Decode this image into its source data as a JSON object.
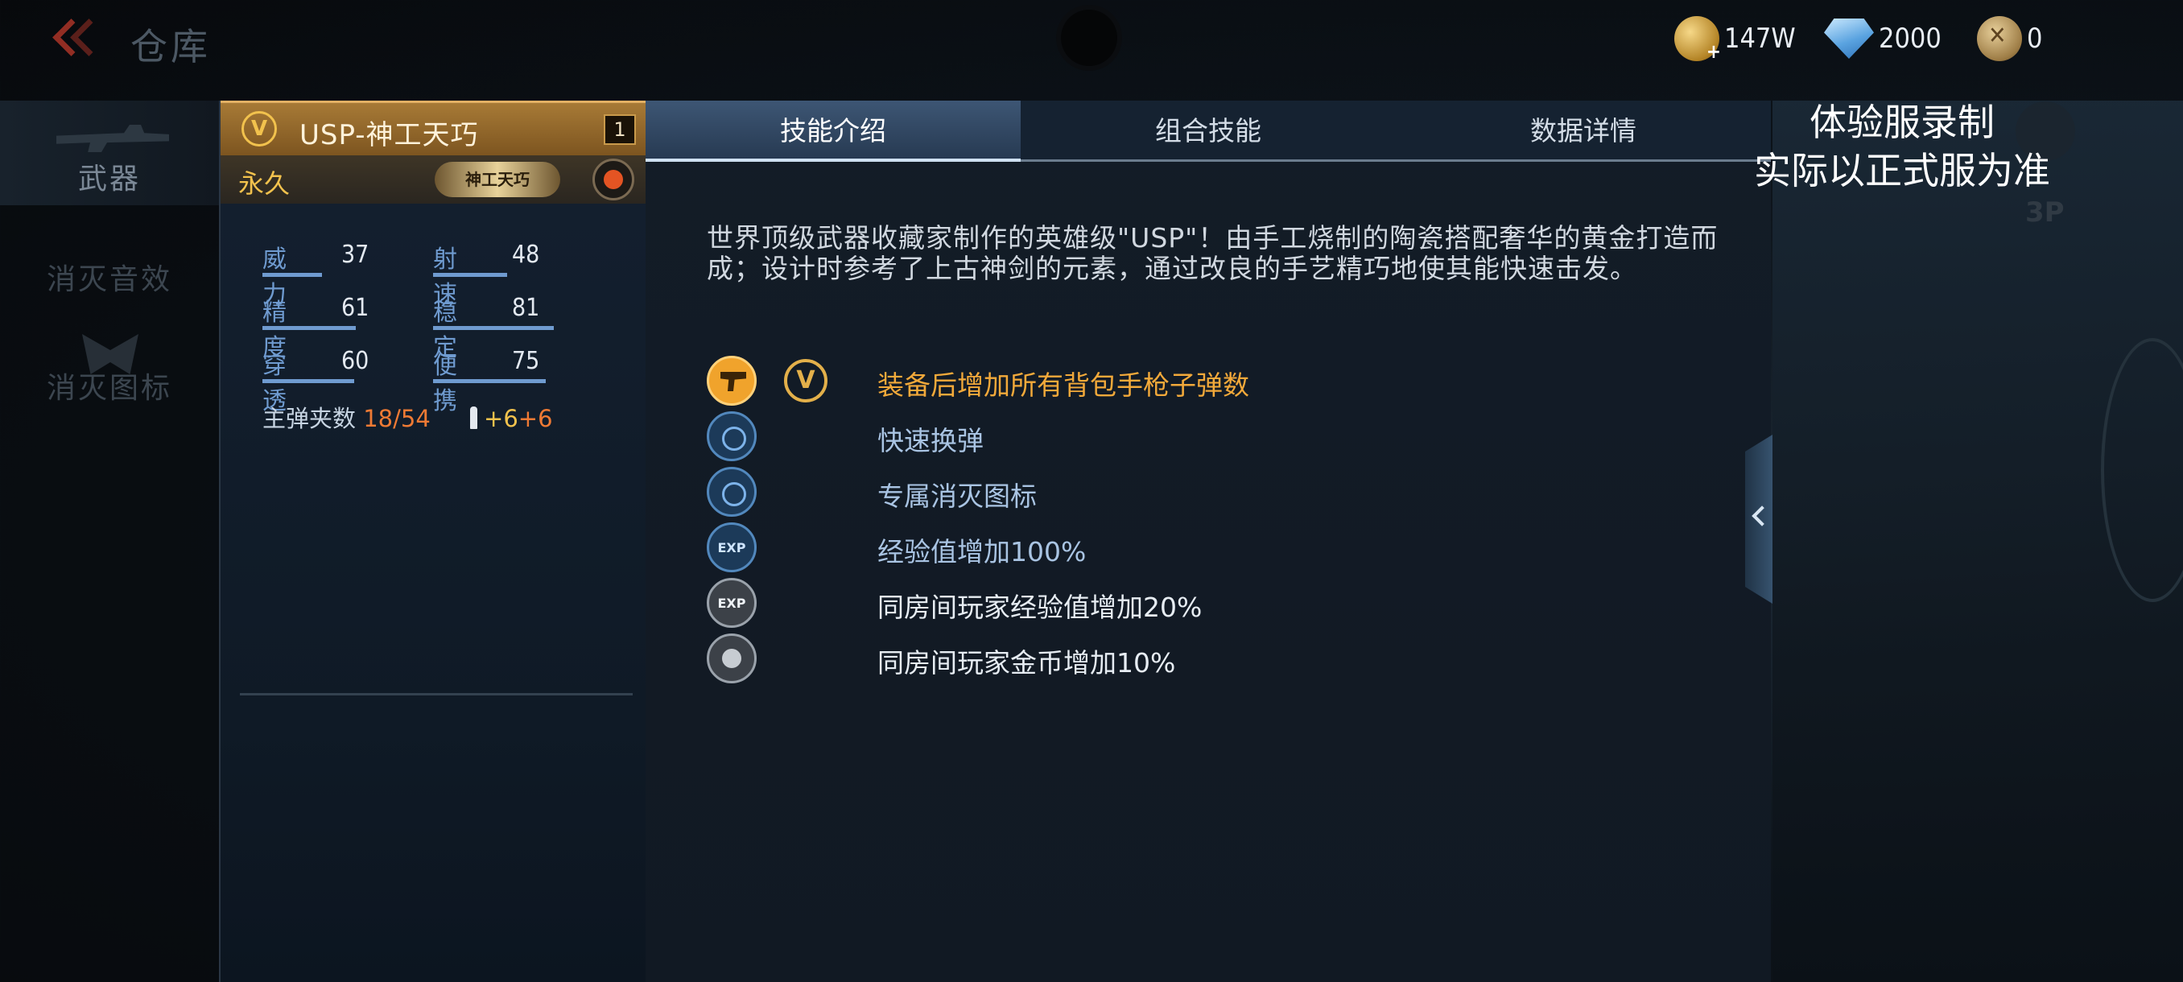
{
  "header": {
    "title": "仓库",
    "currencies": [
      {
        "icon": "gold-coin-icon",
        "value": "147W"
      },
      {
        "icon": "diamond-icon",
        "value": "2000"
      },
      {
        "icon": "token-icon",
        "value": "0"
      }
    ]
  },
  "sidebar": {
    "items": [
      {
        "label": "武器",
        "icon": "rifle-icon",
        "active": true
      },
      {
        "label": "消灭音效",
        "active": false
      },
      {
        "label": "消灭图标",
        "icon": "emblem-icon",
        "active": false
      }
    ]
  },
  "weapon": {
    "tier_badge": "V",
    "name": "USP-神工天巧",
    "count": "1",
    "duration": "永久",
    "plate_label": "神工天巧",
    "stats": [
      {
        "name": "威力",
        "value": "37"
      },
      {
        "name": "射速",
        "value": "48"
      },
      {
        "name": "精度",
        "value": "61"
      },
      {
        "name": "稳定",
        "value": "81"
      },
      {
        "name": "穿透",
        "value": "60"
      },
      {
        "name": "便携",
        "value": "75"
      }
    ],
    "ammo": {
      "label": "主弹夹数",
      "clip": "18",
      "separator": "/",
      "reserve": "54",
      "bonus_a": "+6",
      "bonus_b": "+6"
    }
  },
  "panel": {
    "tabs": [
      {
        "label": "技能介绍",
        "active": true
      },
      {
        "label": "组合技能",
        "active": false
      },
      {
        "label": "数据详情",
        "active": false
      }
    ],
    "description": "世界顶级武器收藏家制作的英雄级\"USP\"！由手工烧制的陶瓷搭配奢华的黄金打造而成；设计时参考了上古神剑的元素，通过改良的手艺精巧地使其能快速击发。",
    "skills": [
      {
        "icon": "pistol-icon",
        "text": "装备后增加所有背包手枪子弹数",
        "style": "gold",
        "badge": "V"
      },
      {
        "icon": "reload-icon",
        "text": "快速换弹",
        "style": "blue"
      },
      {
        "icon": "kill-icon-icon",
        "text": "专属消灭图标",
        "style": "blue"
      },
      {
        "icon": "exp-icon",
        "text": "经验值增加100%",
        "style": "blue",
        "icon_text": "EXP"
      },
      {
        "icon": "room-exp-icon",
        "text": "同房间玩家经验值增加20%",
        "style": "white",
        "icon_text": "EXP"
      },
      {
        "icon": "room-coin-icon",
        "text": "同房间玩家金币增加10%",
        "style": "white"
      }
    ]
  },
  "watermark": {
    "line1": "体验服录制",
    "line2": "实际以正式服为准"
  },
  "scene": {
    "tp_label": "3P"
  }
}
